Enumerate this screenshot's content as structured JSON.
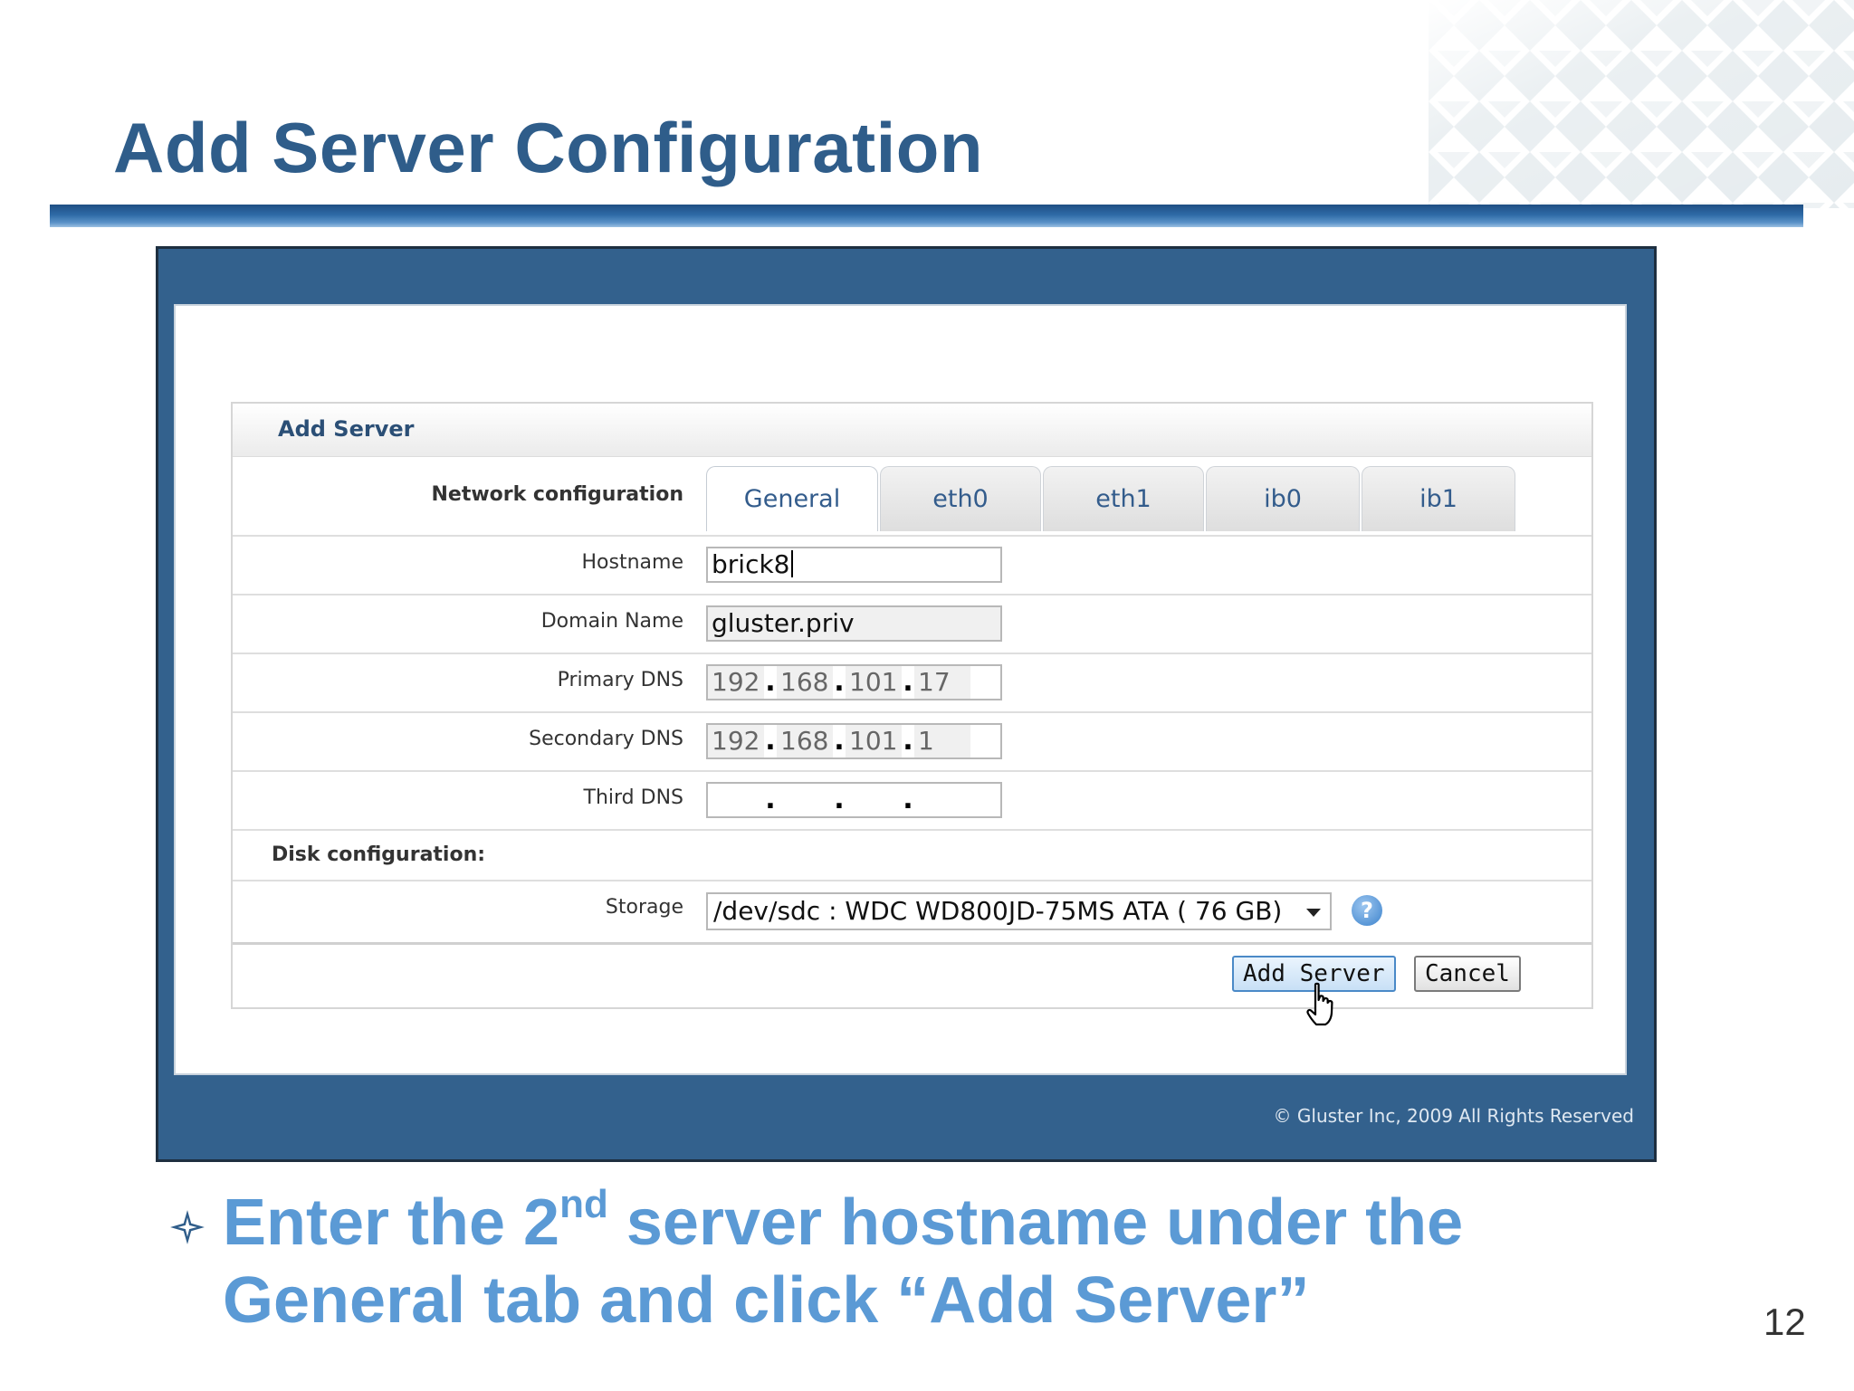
{
  "slide": {
    "title": "Add Server Configuration",
    "bullet_part1": "Enter the 2",
    "bullet_sup": "nd",
    "bullet_part2": " server hostname under the General tab and click “Add Server”",
    "page_number": "12"
  },
  "app": {
    "copyright": "© Gluster Inc, 2009 All Rights Reserved",
    "dialog_title": "Add Server",
    "network_label": "Network configuration",
    "tabs": [
      "General",
      "eth0",
      "eth1",
      "ib0",
      "ib1"
    ],
    "active_tab": "General",
    "fields": {
      "hostname": {
        "label": "Hostname",
        "value": "brick8"
      },
      "domain": {
        "label": "Domain Name",
        "value": "gluster.priv"
      },
      "primary_dns": {
        "label": "Primary DNS",
        "octets": [
          "192",
          "168",
          "101",
          "17"
        ]
      },
      "secondary_dns": {
        "label": "Secondary DNS",
        "octets": [
          "192",
          "168",
          "101",
          "1"
        ]
      },
      "third_dns": {
        "label": "Third DNS",
        "octets": [
          "",
          "",
          "",
          ""
        ]
      }
    },
    "disk_label": "Disk configuration:",
    "storage": {
      "label": "Storage",
      "value": "/dev/sdc : WDC WD800JD-75MS ATA ( 76 GB)"
    },
    "help_icon": "?",
    "buttons": {
      "add": "Add Server",
      "cancel": "Cancel"
    }
  },
  "colors": {
    "title": "#2f5d8a",
    "frame": "#33618d",
    "bullet": "#5b9ad5",
    "tab_text": "#335c8c"
  }
}
